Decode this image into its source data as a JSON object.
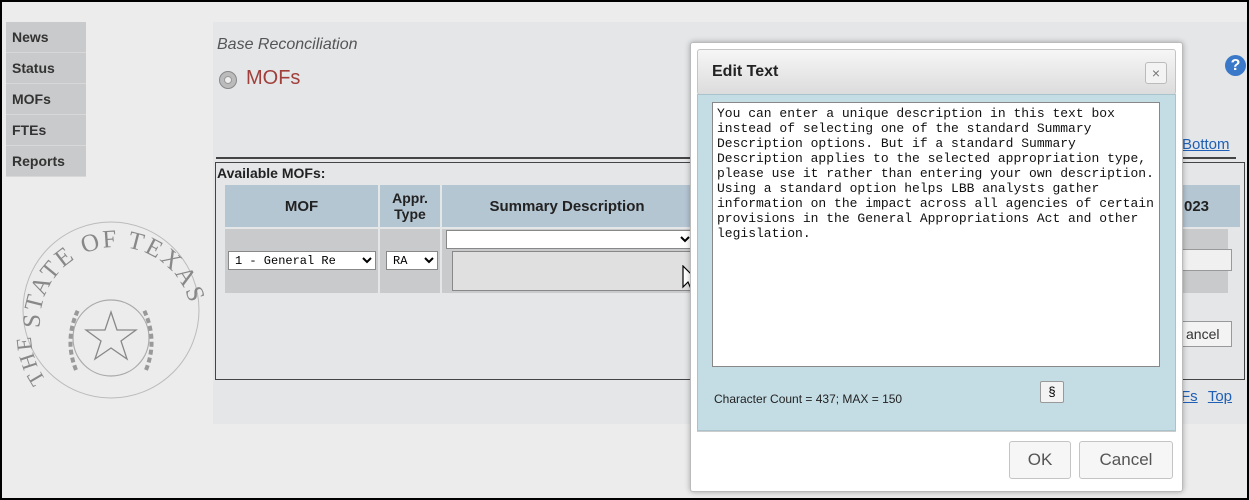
{
  "nav": [
    "News",
    "Status",
    "MOFs",
    "FTEs",
    "Reports"
  ],
  "breadcrumb": "Base Reconciliation",
  "page_title": "MOFs",
  "links": {
    "bottom": "Bottom",
    "mofs": "Fs",
    "top": "Top"
  },
  "table": {
    "caption": "Available MOFs:",
    "headers": {
      "mof": "MOF",
      "appr_type": "Appr. Type",
      "summary": "Summary Description",
      "year": "023"
    },
    "row": {
      "mof_value": "1 - General Re",
      "appr_value": "RA"
    }
  },
  "cancel_partial": "ancel",
  "help_icon": "?",
  "seal": {
    "top_text": "STATE OF TEXAS",
    "left_text": "THE"
  },
  "dialog": {
    "title": "Edit Text",
    "close": "×",
    "text": "You can enter a unique description in this text box instead of selecting one of the standard Summary Description options. But if a standard Summary Description applies to the selected appropriation type, please use it rather than entering your own description. Using a standard option helps LBB analysts gather information on the impact across all agencies of certain provisions in the General Appropriations Act and other legislation.",
    "char_count": "Character Count = 437; MAX = 150",
    "section_button": "§",
    "ok": "OK",
    "cancel": "Cancel"
  }
}
